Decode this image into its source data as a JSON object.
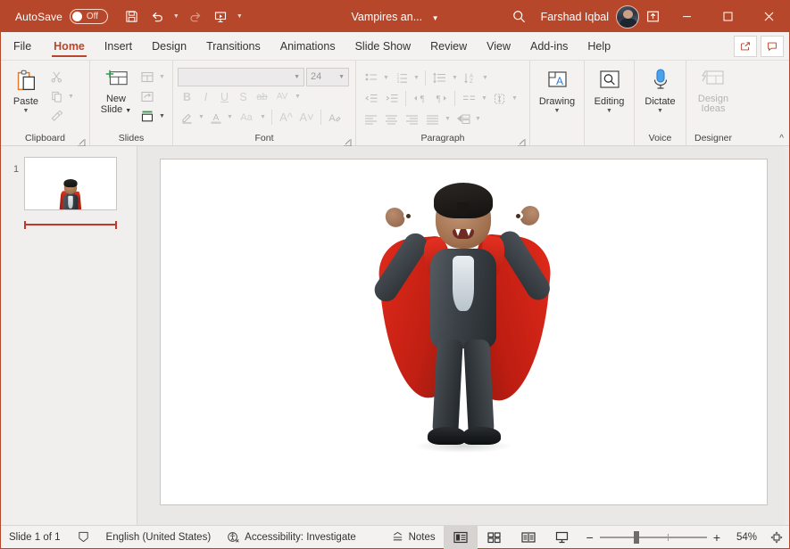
{
  "titlebar": {
    "autosave_label": "AutoSave",
    "autosave_state": "Off",
    "document_title": "Vampires an...",
    "user_name": "Farshad Iqbal",
    "accent_color": "#b7472a",
    "quick_access": [
      {
        "name": "save-icon",
        "tooltip": "Save"
      },
      {
        "name": "undo-icon",
        "tooltip": "Undo"
      },
      {
        "name": "redo-icon",
        "tooltip": "Redo"
      },
      {
        "name": "start-presentation-icon",
        "tooltip": "Start From Beginning"
      },
      {
        "name": "customize-quick-access-icon",
        "tooltip": "Customize Quick Access Toolbar"
      }
    ],
    "window_controls": {
      "minimize": "—",
      "maximize": "☐",
      "close": "✕"
    }
  },
  "tabs": [
    {
      "label": "File",
      "active": false
    },
    {
      "label": "Home",
      "active": true
    },
    {
      "label": "Insert",
      "active": false
    },
    {
      "label": "Design",
      "active": false
    },
    {
      "label": "Transitions",
      "active": false
    },
    {
      "label": "Animations",
      "active": false
    },
    {
      "label": "Slide Show",
      "active": false
    },
    {
      "label": "Review",
      "active": false
    },
    {
      "label": "View",
      "active": false
    },
    {
      "label": "Add-ins",
      "active": false
    },
    {
      "label": "Help",
      "active": false
    }
  ],
  "ribbon": {
    "groups": [
      {
        "label": "Clipboard"
      },
      {
        "label": "Slides"
      },
      {
        "label": "Font"
      },
      {
        "label": "Paragraph"
      },
      {
        "label": "Drawing"
      },
      {
        "label": "Editing"
      },
      {
        "label": "Voice"
      },
      {
        "label": "Designer"
      }
    ],
    "clipboard": {
      "paste_label": "Paste",
      "cut_name": "cut-scissors-icon",
      "copy_name": "copy-icon",
      "format_painter_name": "format-painter-icon"
    },
    "slides": {
      "new_slide_label": "New\nSlide",
      "new_slide_line1": "New",
      "new_slide_line2": "Slide",
      "layout_name": "slide-layout-icon",
      "reset_name": "reset-slide-icon",
      "section_name": "section-icon"
    },
    "font": {
      "font_name_value": "",
      "font_name_placeholder": "",
      "font_size_value": "24",
      "bold": "B",
      "italic": "I",
      "underline": "U",
      "shadow": "S",
      "strikethrough": "ab",
      "char_spacing": "AV",
      "change_case": "Aa",
      "increase_size": "A",
      "decrease_size": "A",
      "clear_formatting": "A",
      "disabled": true
    },
    "paragraph": {
      "bullets_name": "bullets-icon",
      "numbering_name": "numbering-icon",
      "line_spacing_name": "line-spacing-icon",
      "text_direction_name": "text-direction-icon",
      "decrease_indent_name": "decrease-indent-icon",
      "increase_indent_name": "increase-indent-icon",
      "align_left_name": "align-left-icon",
      "center_name": "align-center-icon",
      "align_right_name": "align-right-icon",
      "justify_name": "align-justify-icon",
      "columns_name": "columns-icon",
      "align_text_name": "align-text-icon",
      "convert_smartart_name": "convert-to-smartart-icon"
    },
    "drawing": {
      "label": "Drawing",
      "icon": "drawing-text-box-icon"
    },
    "editing": {
      "label": "Editing",
      "icon": "editing-find-icon"
    },
    "voice": {
      "label": "Dictate",
      "icon": "microphone-icon"
    },
    "designer": {
      "label_line1": "Design",
      "label_line2": "Ideas",
      "icon": "design-ideas-icon",
      "disabled": true
    },
    "collapse_ribbon_icon": "chevron-up-icon",
    "share_icon": "share-icon",
    "comments_icon": "comments-icon"
  },
  "thumbnails": {
    "slides": [
      {
        "number": "1",
        "selected": true
      }
    ]
  },
  "slide": {
    "content_name": "vampire-character-image",
    "background": "#ffffff"
  },
  "status": {
    "slide_count_text": "Slide 1 of 1",
    "notes_indicator_icon": "slide-notes-icon",
    "language": "English (United States)",
    "accessibility": "Accessibility: Investigate",
    "accessibility_icon": "accessibility-icon",
    "notes_label": "Notes",
    "notes_icon": "notes-caret-icon",
    "views": [
      {
        "name": "normal-view-button",
        "active": true
      },
      {
        "name": "slide-sorter-view-button",
        "active": false
      },
      {
        "name": "reading-view-button",
        "active": false
      },
      {
        "name": "slide-show-view-button",
        "active": false
      }
    ],
    "zoom_out": "−",
    "zoom_in": "+",
    "zoom_percent": "54%",
    "fit_to_window_icon": "fit-slide-to-window-icon"
  }
}
